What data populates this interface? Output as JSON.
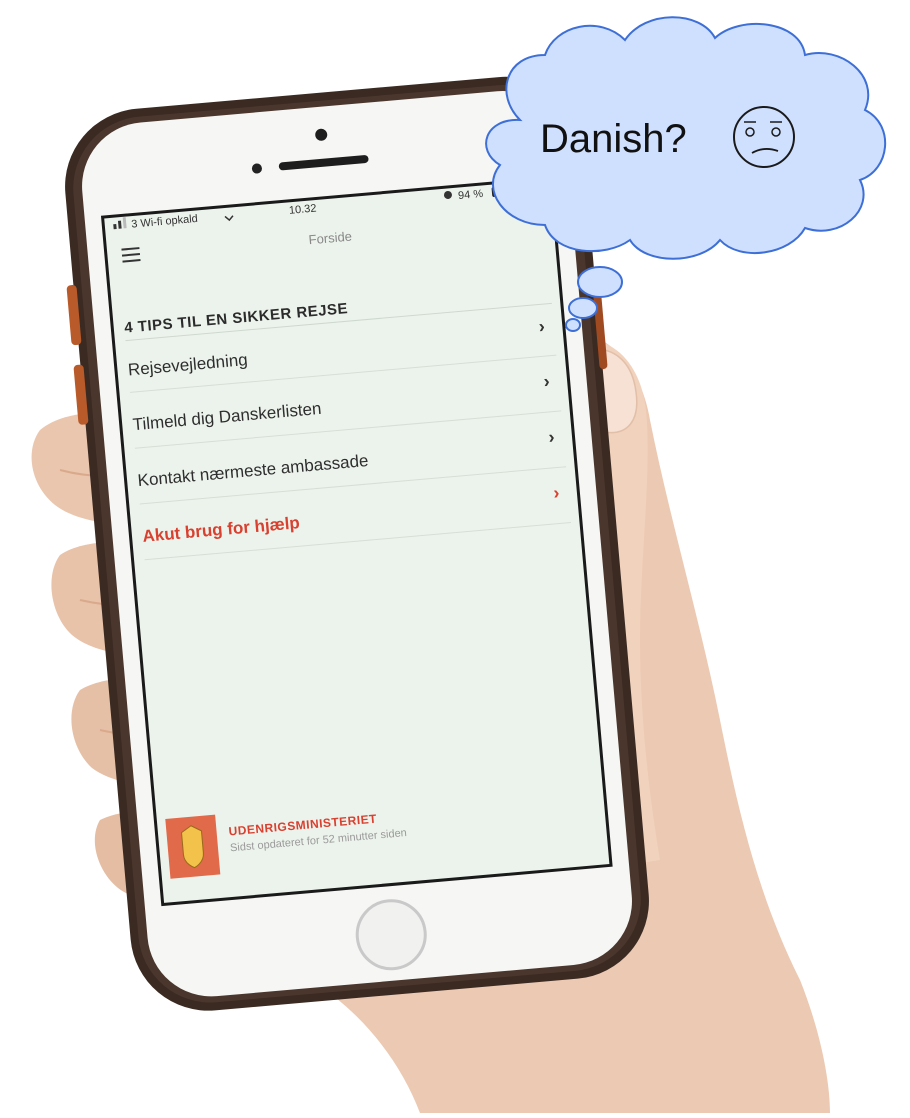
{
  "thought_bubble": {
    "text": "Danish?",
    "emoji": "confused-face-icon"
  },
  "status_bar": {
    "carrier": "3 Wi-fi opkald",
    "time": "10.32",
    "battery": "94 %"
  },
  "nav_bar": {
    "title": "Forside"
  },
  "section": {
    "heading": "4 TIPS TIL EN SIKKER REJSE"
  },
  "menu": {
    "items": [
      {
        "label": "Rejsevejledning"
      },
      {
        "label": "Tilmeld dig Danskerlisten"
      },
      {
        "label": "Kontakt nærmeste ambassade"
      },
      {
        "label": "Akut brug for hjælp"
      }
    ]
  },
  "footer": {
    "org": "UDENRIGSMINISTERIET",
    "updated": "Sidst opdateret for 52 minutter siden"
  },
  "colors": {
    "accent_red": "#d9402f",
    "bubble_fill": "#cfe0ff",
    "bubble_stroke": "#3d6fd6",
    "screen_bg": "#ecf3ec"
  }
}
